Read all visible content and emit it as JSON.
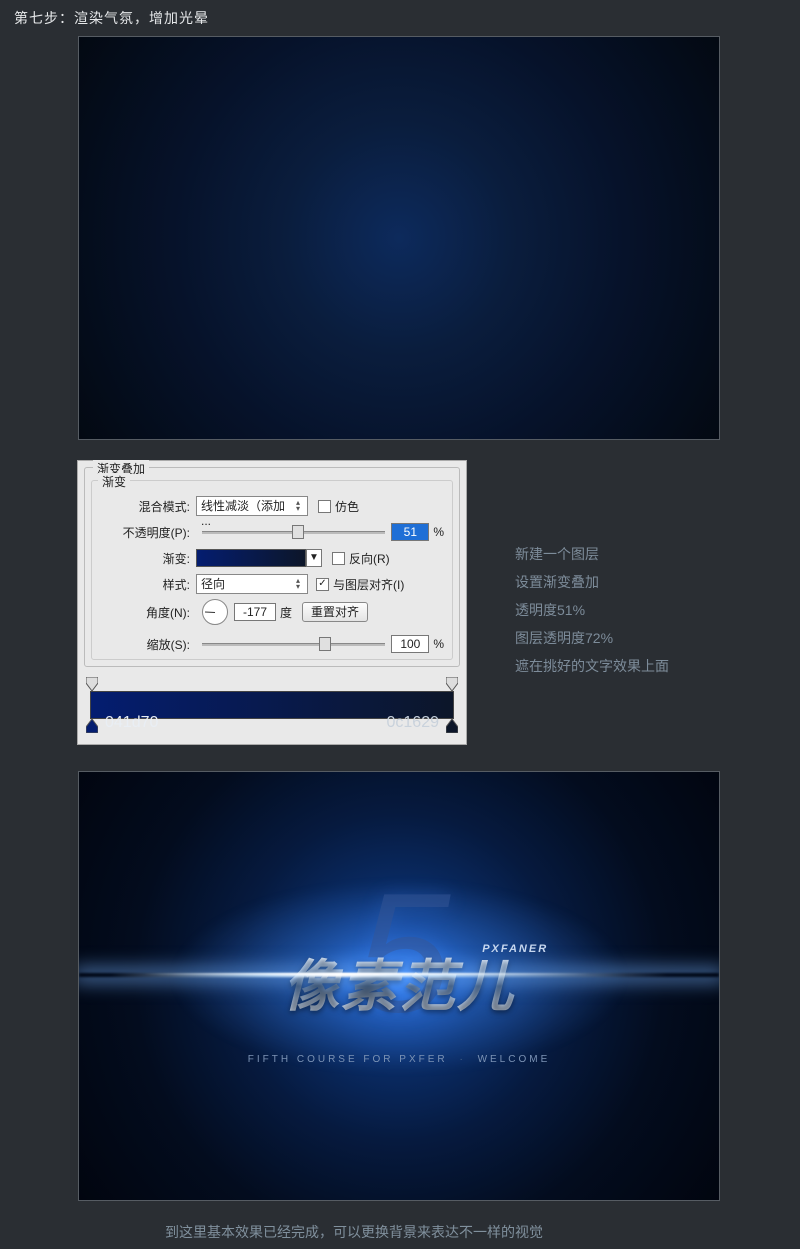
{
  "step_title": "第七步：渲染气氛，增加光晕",
  "panel": {
    "group_title": "渐变叠加",
    "inner_title": "渐变",
    "blend_label": "混合模式:",
    "blend_value": "线性减淡（添加 ...",
    "dither_label": "仿色",
    "opacity_label": "不透明度(P):",
    "opacity_value": "51",
    "percent": "%",
    "gradient_label": "渐变:",
    "reverse_label": "反向(R)",
    "style_label": "样式:",
    "style_value": "径向",
    "align_label": "与图层对齐(I)",
    "angle_label": "角度(N):",
    "angle_value": "-177",
    "angle_unit": "度",
    "reset_align": "重置对齐",
    "scale_label": "缩放(S):",
    "scale_value": "100",
    "hex_left": "041d70",
    "hex_right": "0c1629"
  },
  "notes": {
    "l1": "新建一个图层",
    "l2": "设置渐变叠加",
    "l3": "透明度51%",
    "l4": "图层透明度72%",
    "l5": "遮在挑好的文字效果上面"
  },
  "artwork": {
    "big5": "5",
    "cn": "像素范儿",
    "en_badge": "PXFANER",
    "sub_left": "FIFTH COURSE FOR PXFER",
    "sub_dash": "·",
    "sub_right": "WELCOME"
  },
  "footer": "到这里基本效果已经完成，可以更换背景来表达不一样的视觉"
}
